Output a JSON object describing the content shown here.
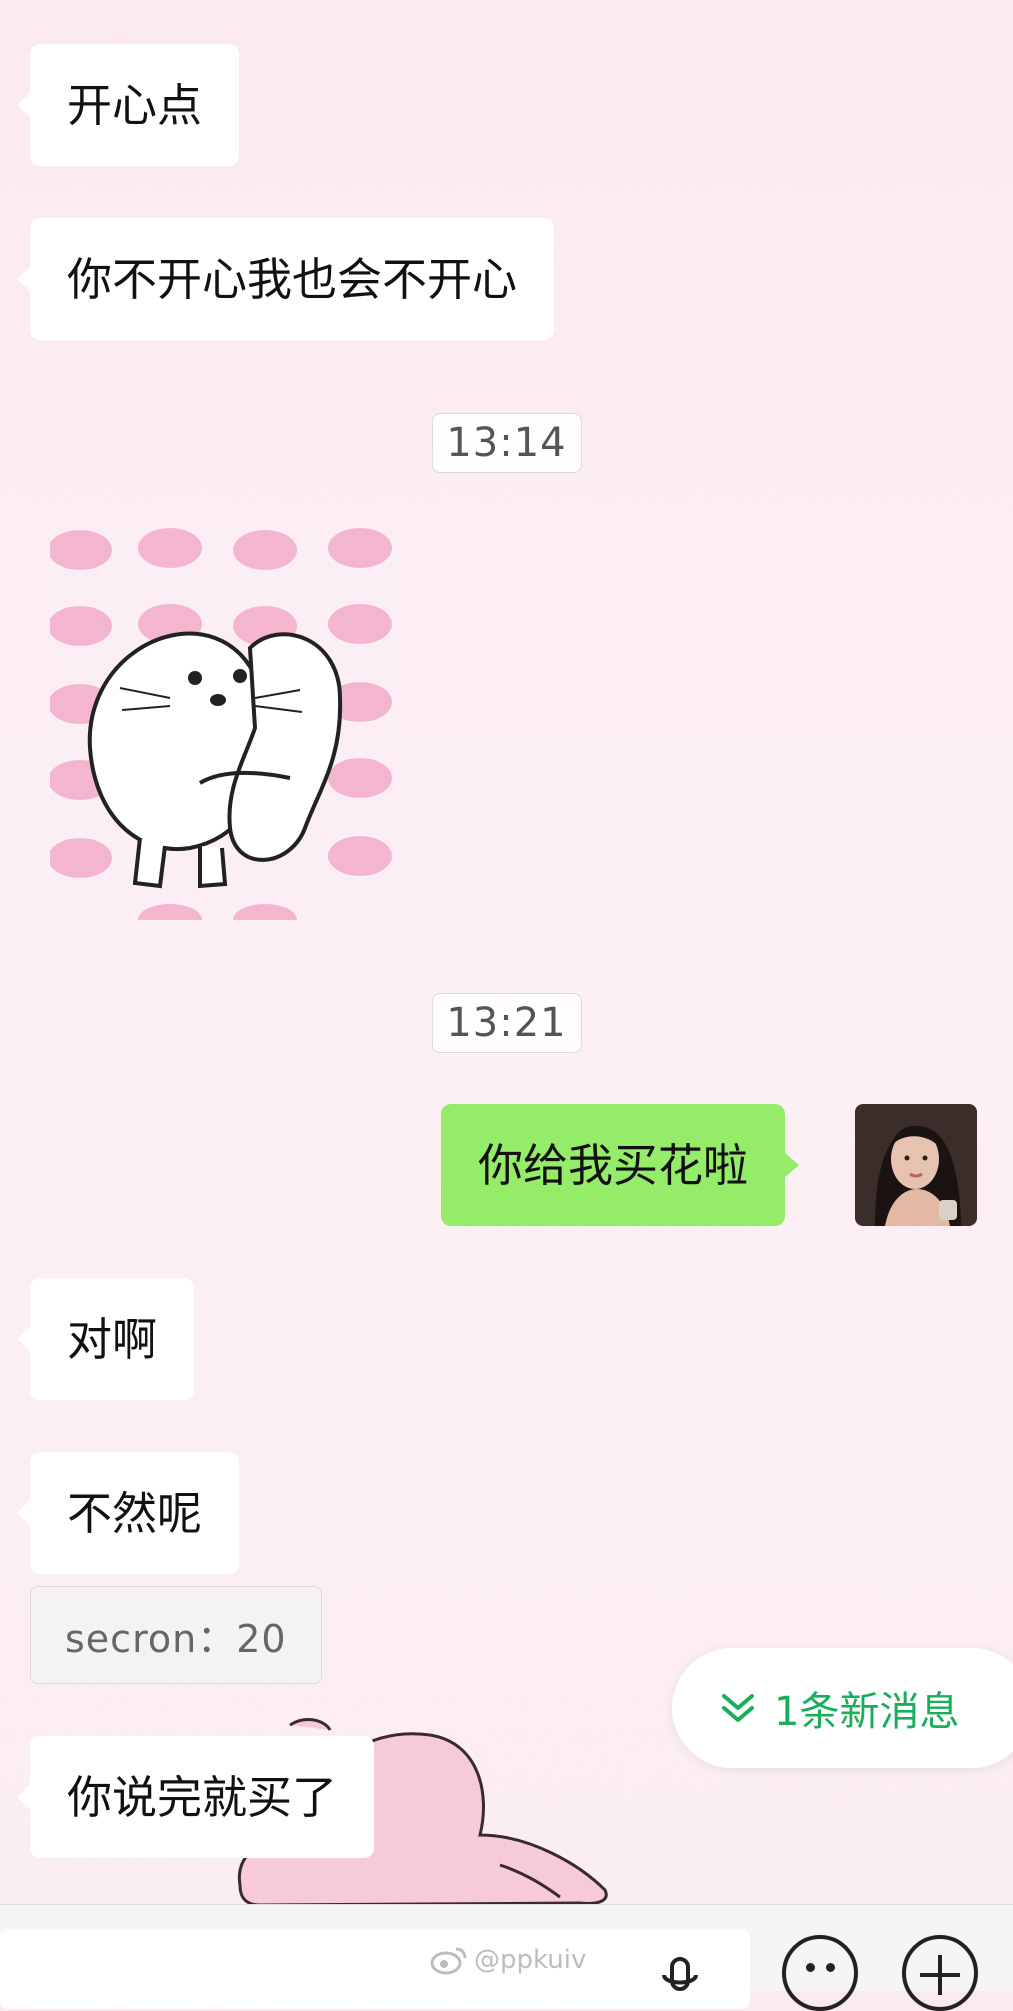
{
  "messages": [
    {
      "text": "开心点"
    },
    {
      "text": "你不开心我也会不开心"
    },
    {
      "text": "你给我买花啦"
    },
    {
      "text": "对啊"
    },
    {
      "text": "不然呢"
    },
    {
      "text": "你说完就买了"
    }
  ],
  "timestamps": [
    "13:14",
    "13:21"
  ],
  "quote": {
    "text": "secron：20"
  },
  "new_message": {
    "label": "1条新消息",
    "color": "#1aad5a"
  },
  "bottom": {
    "watermark": "@ppkuiv"
  },
  "colors": {
    "outgoing_bubble": "#95ec69",
    "incoming_bubble": "#ffffff"
  },
  "icons": [
    "seal-hug-sticker",
    "avatar-photo",
    "double-chevron-down-icon",
    "weibo-icon",
    "voice-icon",
    "emoji-icon",
    "plus-icon"
  ]
}
